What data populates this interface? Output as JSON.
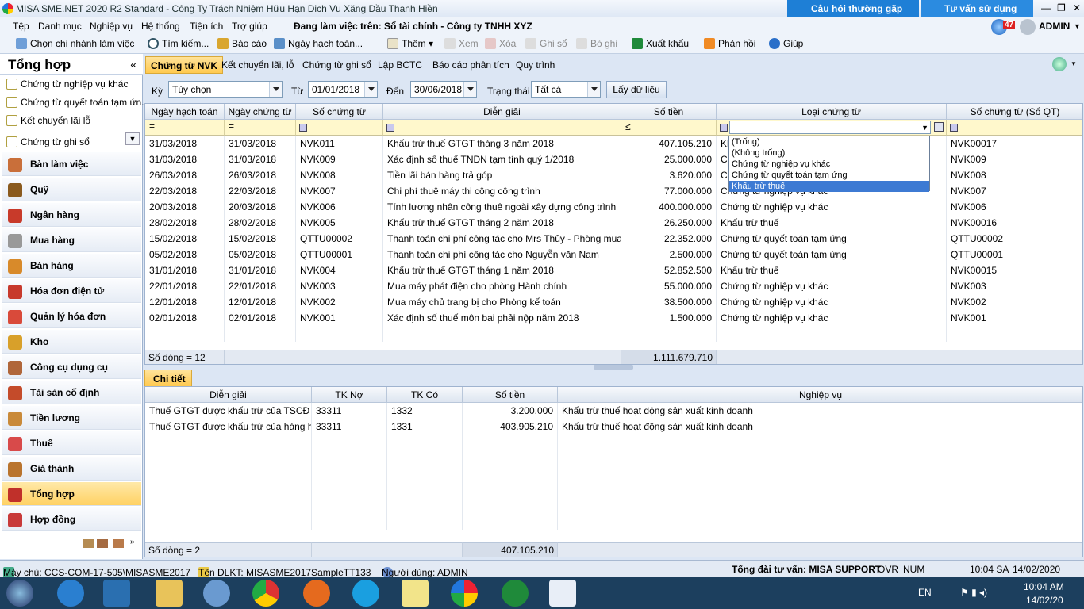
{
  "window": {
    "title": "MISA SME.NET 2020 R2 Standard - Công Ty Trách Nhiệm Hữu Hạn Dịch Vụ Xăng Dầu Thanh Hiền",
    "faq": "Câu hỏi thường gặp",
    "advice": "Tư vấn sử dụng",
    "min": "—",
    "restore": "❐",
    "close": "✕"
  },
  "menu": {
    "items": [
      "Tệp",
      "Danh mục",
      "Nghiệp vụ",
      "Hệ thống",
      "Tiện ích",
      "Trợ giúp"
    ],
    "working_on": "Đang làm việc trên: Sổ tài chính - Công ty TNHH XYZ",
    "notif_count": "47",
    "user": "ADMIN"
  },
  "toolbar": {
    "branch": "Chọn chi nhánh làm việc",
    "search": "Tìm kiếm...",
    "report": "Báo cáo",
    "posting_date": "Ngày hạch toán...",
    "add": "Thêm",
    "view": "Xem",
    "delete": "Xóa",
    "post": "Ghi sổ",
    "unpost": "Bỏ ghi",
    "export": "Xuất khẩu",
    "feedback": "Phản hồi",
    "help": "Giúp"
  },
  "sidebar": {
    "title": "Tổng hợp",
    "collapse": "«",
    "subitems": [
      "Chứng từ nghiệp vụ khác",
      "Chứng từ quyết toán tạm ứn...",
      "Kết chuyển lãi lỗ",
      "Chứng từ ghi sổ"
    ],
    "modules": [
      "Bàn làm việc",
      "Quỹ",
      "Ngân hàng",
      "Mua hàng",
      "Bán hàng",
      "Hóa đơn điện tử",
      "Quản lý hóa đơn",
      "Kho",
      "Công cụ dụng cụ",
      "Tài sản cố định",
      "Tiền lương",
      "Thuế",
      "Giá thành",
      "Tổng hợp",
      "Hợp đồng"
    ]
  },
  "tabs": [
    "Chứng từ NVK",
    "Kết chuyển lãi, lỗ",
    "Chứng từ ghi sổ",
    "Lập BCTC",
    "Báo cáo phân tích",
    "Quy trình"
  ],
  "filter": {
    "period_label": "Kỳ",
    "period": "Tùy chọn",
    "from_label": "Từ",
    "from": "01/01/2018",
    "to_label": "Đến",
    "to": "30/06/2018",
    "status_label": "Trạng thái",
    "status": "Tất cả",
    "fetch": "Lấy dữ liệu"
  },
  "grid1": {
    "headers": [
      "Ngày hạch toán",
      "Ngày chứng từ",
      "Số chứng từ",
      "Diễn giải",
      "Số tiền",
      "Loại chứng từ",
      "Số chứng từ (Sổ QT)"
    ],
    "rows": [
      [
        "31/03/2018",
        "31/03/2018",
        "NVK011",
        "Khấu trừ thuế GTGT tháng 3 năm 2018",
        "407.105.210",
        "Kh",
        "NVK00017"
      ],
      [
        "31/03/2018",
        "31/03/2018",
        "NVK009",
        "Xác định số thuế TNDN tạm tính quý 1/2018",
        "25.000.000",
        "Ch",
        "NVK009"
      ],
      [
        "26/03/2018",
        "26/03/2018",
        "NVK008",
        "Tiền lãi bán hàng trả góp",
        "3.620.000",
        "Ch",
        "NVK008"
      ],
      [
        "22/03/2018",
        "22/03/2018",
        "NVK007",
        "Chi phí thuê máy thi công công trình",
        "77.000.000",
        "Chứng từ nghiệp vụ khác",
        "NVK007"
      ],
      [
        "20/03/2018",
        "20/03/2018",
        "NVK006",
        "Tính lương nhân công thuê ngoài xây dựng công trình",
        "400.000.000",
        "Chứng từ nghiệp vụ khác",
        "NVK006"
      ],
      [
        "28/02/2018",
        "28/02/2018",
        "NVK005",
        "Khấu trừ thuế GTGT tháng 2 năm 2018",
        "26.250.000",
        "Khấu trừ thuế",
        "NVK00016"
      ],
      [
        "15/02/2018",
        "15/02/2018",
        "QTTU00002",
        "Thanh toán chi phí công tác cho Mrs Thủy - Phòng mua h",
        "22.352.000",
        "Chứng từ quyết toán tạm ứng",
        "QTTU00002"
      ],
      [
        "05/02/2018",
        "05/02/2018",
        "QTTU00001",
        "Thanh toán chi phí công tác cho Nguyễn văn Nam",
        "2.500.000",
        "Chứng từ quyết toán tạm ứng",
        "QTTU00001"
      ],
      [
        "31/01/2018",
        "31/01/2018",
        "NVK004",
        "Khấu trừ thuế GTGT tháng 1 năm 2018",
        "52.852.500",
        "Khấu trừ thuế",
        "NVK00015"
      ],
      [
        "22/01/2018",
        "22/01/2018",
        "NVK003",
        "Mua máy phát điện cho phòng Hành chính",
        "55.000.000",
        "Chứng từ nghiệp vụ khác",
        "NVK003"
      ],
      [
        "12/01/2018",
        "12/01/2018",
        "NVK002",
        "Mua máy chủ trang bị cho Phòng kế toán",
        "38.500.000",
        "Chứng từ nghiệp vụ khác",
        "NVK002"
      ],
      [
        "02/01/2018",
        "02/01/2018",
        "NVK001",
        "Xác định số thuế môn bai phải nộp năm 2018",
        "1.500.000",
        "Chứng từ nghiệp vụ khác",
        "NVK001"
      ]
    ],
    "row_count": "Số dòng = 12",
    "total": "1.111.679.710",
    "popup": [
      "(Trống)",
      "(Không trống)",
      "Chứng từ nghiệp vụ khác",
      "Chứng từ quyết toán tạm ứng",
      "Khấu trừ thuế"
    ]
  },
  "detail": {
    "tab": "Chi tiết",
    "headers": [
      "Diễn giải",
      "TK Nợ",
      "TK Có",
      "Số tiền",
      "Nghiệp vụ"
    ],
    "rows": [
      [
        "Thuế GTGT được khấu trừ của TSCĐ",
        "33311",
        "1332",
        "3.200.000",
        "Khấu trừ thuế hoạt động sản xuất kinh doanh"
      ],
      [
        "Thuế GTGT được khấu trừ của hàng hó",
        "33311",
        "1331",
        "403.905.210",
        "Khấu trừ thuế hoạt động sản xuất kinh doanh"
      ]
    ],
    "row_count": "Số dòng = 2",
    "total": "407.105.210"
  },
  "status": {
    "server": "Máy chủ: CCS-COM-17-505\\MISASME2017",
    "db": "Tên DLKT: MISASME2017SampleTT133",
    "user": "Người dùng: ADMIN",
    "hotline": "Tổng đài tư vấn: MISA SUPPORT",
    "ovr": "OVR",
    "num": "NUM",
    "time": "10:04 SA",
    "date": "14/02/2020"
  },
  "taskbar": {
    "lang": "EN",
    "clock_time": "10:04 AM",
    "clock_date": "14/02/20"
  }
}
